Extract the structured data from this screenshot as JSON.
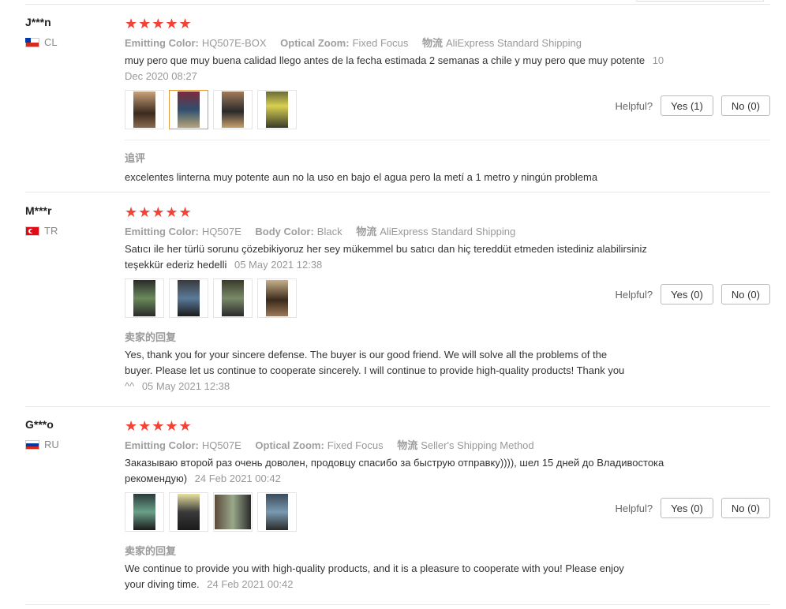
{
  "labels": {
    "helpful": "Helpful?"
  },
  "reviews": [
    {
      "user": "J***n",
      "country": "CL",
      "props": [
        {
          "label": "Emitting Color:",
          "value": "HQ507E-BOX"
        },
        {
          "label": "Optical Zoom:",
          "value": "Fixed Focus"
        },
        {
          "label": "物流",
          "value": "AliExpress Standard Shipping"
        }
      ],
      "text": "muy pero que muy buena calidad llego antes de la fecha estimada 2 semanas a chile y muy pero que muy potente",
      "date_part1": "10",
      "date_part2": "Dec 2020 08:27",
      "yes_label": "Yes (1)",
      "no_label": "No (0)",
      "followup_title": "追评",
      "followup_text": "excelentes linterna muy potente aun no la uso en bajo el agua pero la metí a 1 metro y ningún problema"
    },
    {
      "user": "M***r",
      "country": "TR",
      "props": [
        {
          "label": "Emitting Color:",
          "value": "HQ507E"
        },
        {
          "label": "Body Color:",
          "value": "Black"
        },
        {
          "label": "物流",
          "value": "AliExpress Standard Shipping"
        }
      ],
      "text_line1": "Satıcı ile her türlü sorunu çözebikiyoruz her sey mükemmel bu satıcı dan hiç tereddüt etmeden istediniz alabilirsiniz",
      "text_line2": "teşekkür ederiz hedelli",
      "date": "05 May 2021 12:38",
      "yes_label": "Yes (0)",
      "no_label": "No (0)",
      "reply_title": "卖家的回复",
      "reply_line1": "Yes, thank you for your sincere defense. The buyer is our good friend. We will solve all the problems of the",
      "reply_line2": "buyer. Please let us continue to cooperate sincerely. I will continue to provide high-quality products! Thank you",
      "reply_line3": "^^",
      "reply_date": "05 May 2021 12:38"
    },
    {
      "user": "G***o",
      "country": "RU",
      "props": [
        {
          "label": "Emitting Color:",
          "value": "HQ507E"
        },
        {
          "label": "Optical Zoom:",
          "value": "Fixed Focus"
        },
        {
          "label": "物流",
          "value": "Seller's Shipping Method"
        }
      ],
      "text_line1": "Заказываю второй раз очень доволен, продовцу спасибо за быструю отправку)))), шел 15 дней до Владивостока",
      "text_line2": "рекомендую)",
      "date": "24 Feb 2021 00:42",
      "yes_label": "Yes (0)",
      "no_label": "No (0)",
      "reply_title": "卖家的回复",
      "reply_line1": "We continue to provide you with high-quality products, and it is a pleasure to cooperate with you! Please enjoy",
      "reply_line2": "your diving time.",
      "reply_date": "24 Feb 2021 00:42"
    }
  ],
  "colors": {
    "star": "#f44336",
    "active_thumb_border": "#e49a38",
    "muted": "#999999"
  }
}
